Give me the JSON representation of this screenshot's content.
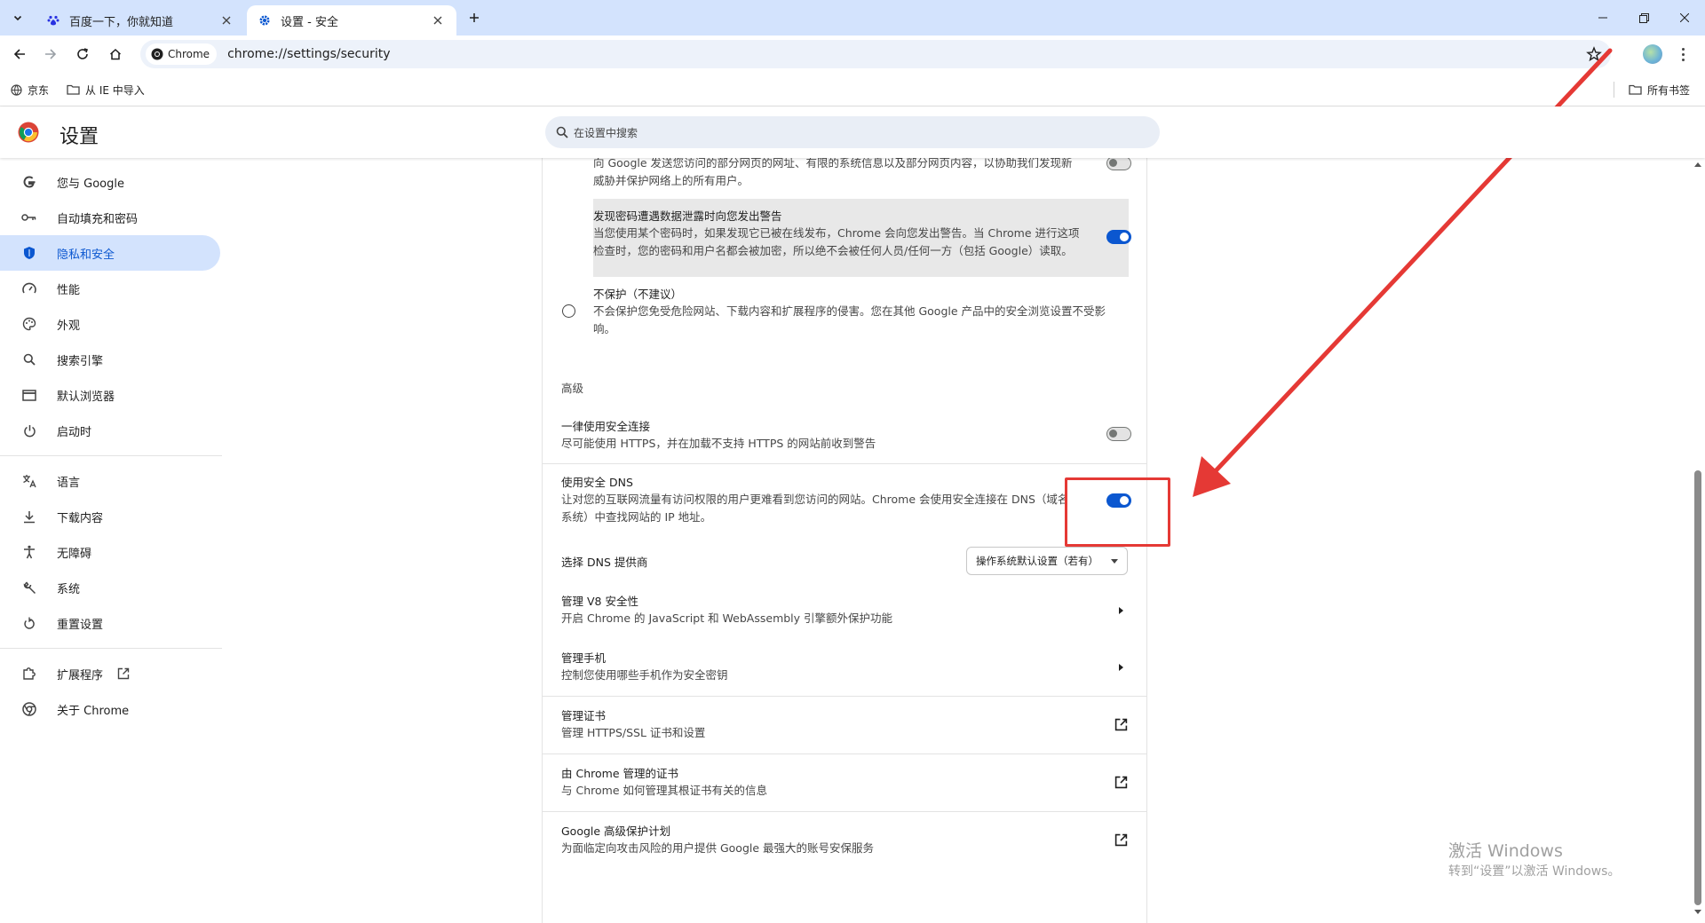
{
  "tabs": [
    {
      "title": "百度一下，你就知道",
      "active": false
    },
    {
      "title": "设置 - 安全",
      "active": true
    }
  ],
  "toolbar": {
    "chip_label": "Chrome",
    "url": "chrome://settings/security"
  },
  "bookmarks": {
    "items": [
      "京东",
      "从 IE 中导入"
    ],
    "all_bookmarks": "所有书签"
  },
  "header": {
    "title": "设置",
    "search_placeholder": "在设置中搜索"
  },
  "sidebar": {
    "items": [
      {
        "label": "您与 Google",
        "icon": "google-icon"
      },
      {
        "label": "自动填充和密码",
        "icon": "key-icon"
      },
      {
        "label": "隐私和安全",
        "icon": "shield-icon",
        "active": true
      },
      {
        "label": "性能",
        "icon": "speedometer-icon"
      },
      {
        "label": "外观",
        "icon": "palette-icon"
      },
      {
        "label": "搜索引擎",
        "icon": "search-icon"
      },
      {
        "label": "默认浏览器",
        "icon": "browser-icon"
      },
      {
        "label": "启动时",
        "icon": "power-icon"
      },
      {
        "label": "语言",
        "icon": "translate-icon"
      },
      {
        "label": "下载内容",
        "icon": "download-icon"
      },
      {
        "label": "无障碍",
        "icon": "accessibility-icon"
      },
      {
        "label": "系统",
        "icon": "wrench-icon"
      },
      {
        "label": "重置设置",
        "icon": "reset-icon"
      },
      {
        "label": "扩展程序",
        "icon": "extension-icon"
      },
      {
        "label": "关于 Chrome",
        "icon": "chrome-icon"
      }
    ]
  },
  "main": {
    "partial_text_1": "向 Google 发送您访问的部分网页的网址、有限的系统信息以及部分网页内容，以协助我们发现新",
    "partial_text_2": "威胁并保护网络上的所有用户。",
    "password_leak": {
      "title": "发现密码遭遇数据泄露时向您发出警告",
      "desc_1": "当您使用某个密码时，如果发现它已被在线发布，Chrome 会向您发出警告。当 Chrome 进行这项",
      "desc_2": "检查时，您的密码和用户名都会被加密，所以绝不会被任何人员/任何一方（包括 Google）读取。",
      "enabled": true
    },
    "no_protection": {
      "title": "不保护（不建议）",
      "desc_1": "不会保护您免受危险网站、下载内容和扩展程序的侵害。您在其他 Google 产品中的安全浏览设置不受影",
      "desc_2": "响。"
    },
    "advanced_heading": "高级",
    "https": {
      "title": "一律使用安全连接",
      "desc": "尽可能使用 HTTPS，并在加载不支持 HTTPS 的网站前收到警告",
      "enabled": false
    },
    "secure_dns": {
      "title": "使用安全 DNS",
      "desc_1": "让对您的互联网流量有访问权限的用户更难看到您访问的网站。Chrome 会使用安全连接在 DNS（域名",
      "desc_2": "系统）中查找网站的 IP 地址。",
      "enabled": true
    },
    "dns_provider": {
      "label": "选择 DNS 提供商",
      "selected": "操作系统默认设置（若有）"
    },
    "v8": {
      "title": "管理 V8 安全性",
      "desc": "开启 Chrome 的 JavaScript 和 WebAssembly 引擎额外保护功能"
    },
    "phones": {
      "title": "管理手机",
      "desc": "控制您使用哪些手机作为安全密钥"
    },
    "certs": {
      "title": "管理证书",
      "desc": "管理 HTTPS/SSL 证书和设置"
    },
    "chrome_certs": {
      "title": "由 Chrome 管理的证书",
      "desc": "与 Chrome 如何管理其根证书有关的信息"
    },
    "advanced_protection": {
      "title": "Google 高级保护计划",
      "desc": "为面临定向攻击风险的用户提供 Google 最强大的账号安保服务"
    }
  },
  "watermark": {
    "line1": "激活 Windows",
    "line2": "转到“设置”以激活 Windows。"
  },
  "colors": {
    "accent": "#0b57d0",
    "annotation": "#e53935",
    "tabstrip": "#d3e3fd"
  }
}
